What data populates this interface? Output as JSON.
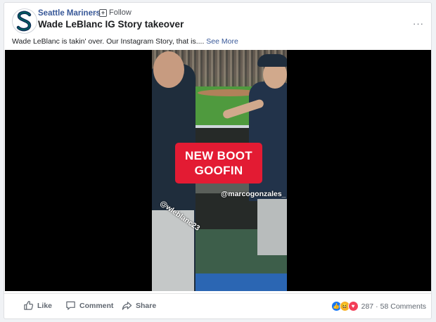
{
  "post": {
    "page_name": "Seattle Mariners",
    "separator": "·",
    "follow_label": "Follow",
    "title": "Wade LeBlanc IG Story takeover",
    "text": "Wade LeBlanc is takin' over. Our Instagram Story, that is....",
    "see_more": "See More",
    "menu": "···"
  },
  "video": {
    "sticker_line1": "NEW BOOT",
    "sticker_line2": "GOOFIN",
    "mention_left": "@wleblanc23",
    "mention_right": "@marcogonzales_"
  },
  "actions": {
    "like": "Like",
    "comment": "Comment",
    "share": "Share"
  },
  "reactions": {
    "count": "287",
    "separator": "·",
    "comments": "58 Comments",
    "types": [
      "like-icon",
      "haha-icon",
      "love-icon"
    ]
  },
  "colors": {
    "link": "#385898",
    "sticker": "#e31b33",
    "like": "#1877f2",
    "haha": "#f7b125",
    "love": "#f33e58"
  }
}
